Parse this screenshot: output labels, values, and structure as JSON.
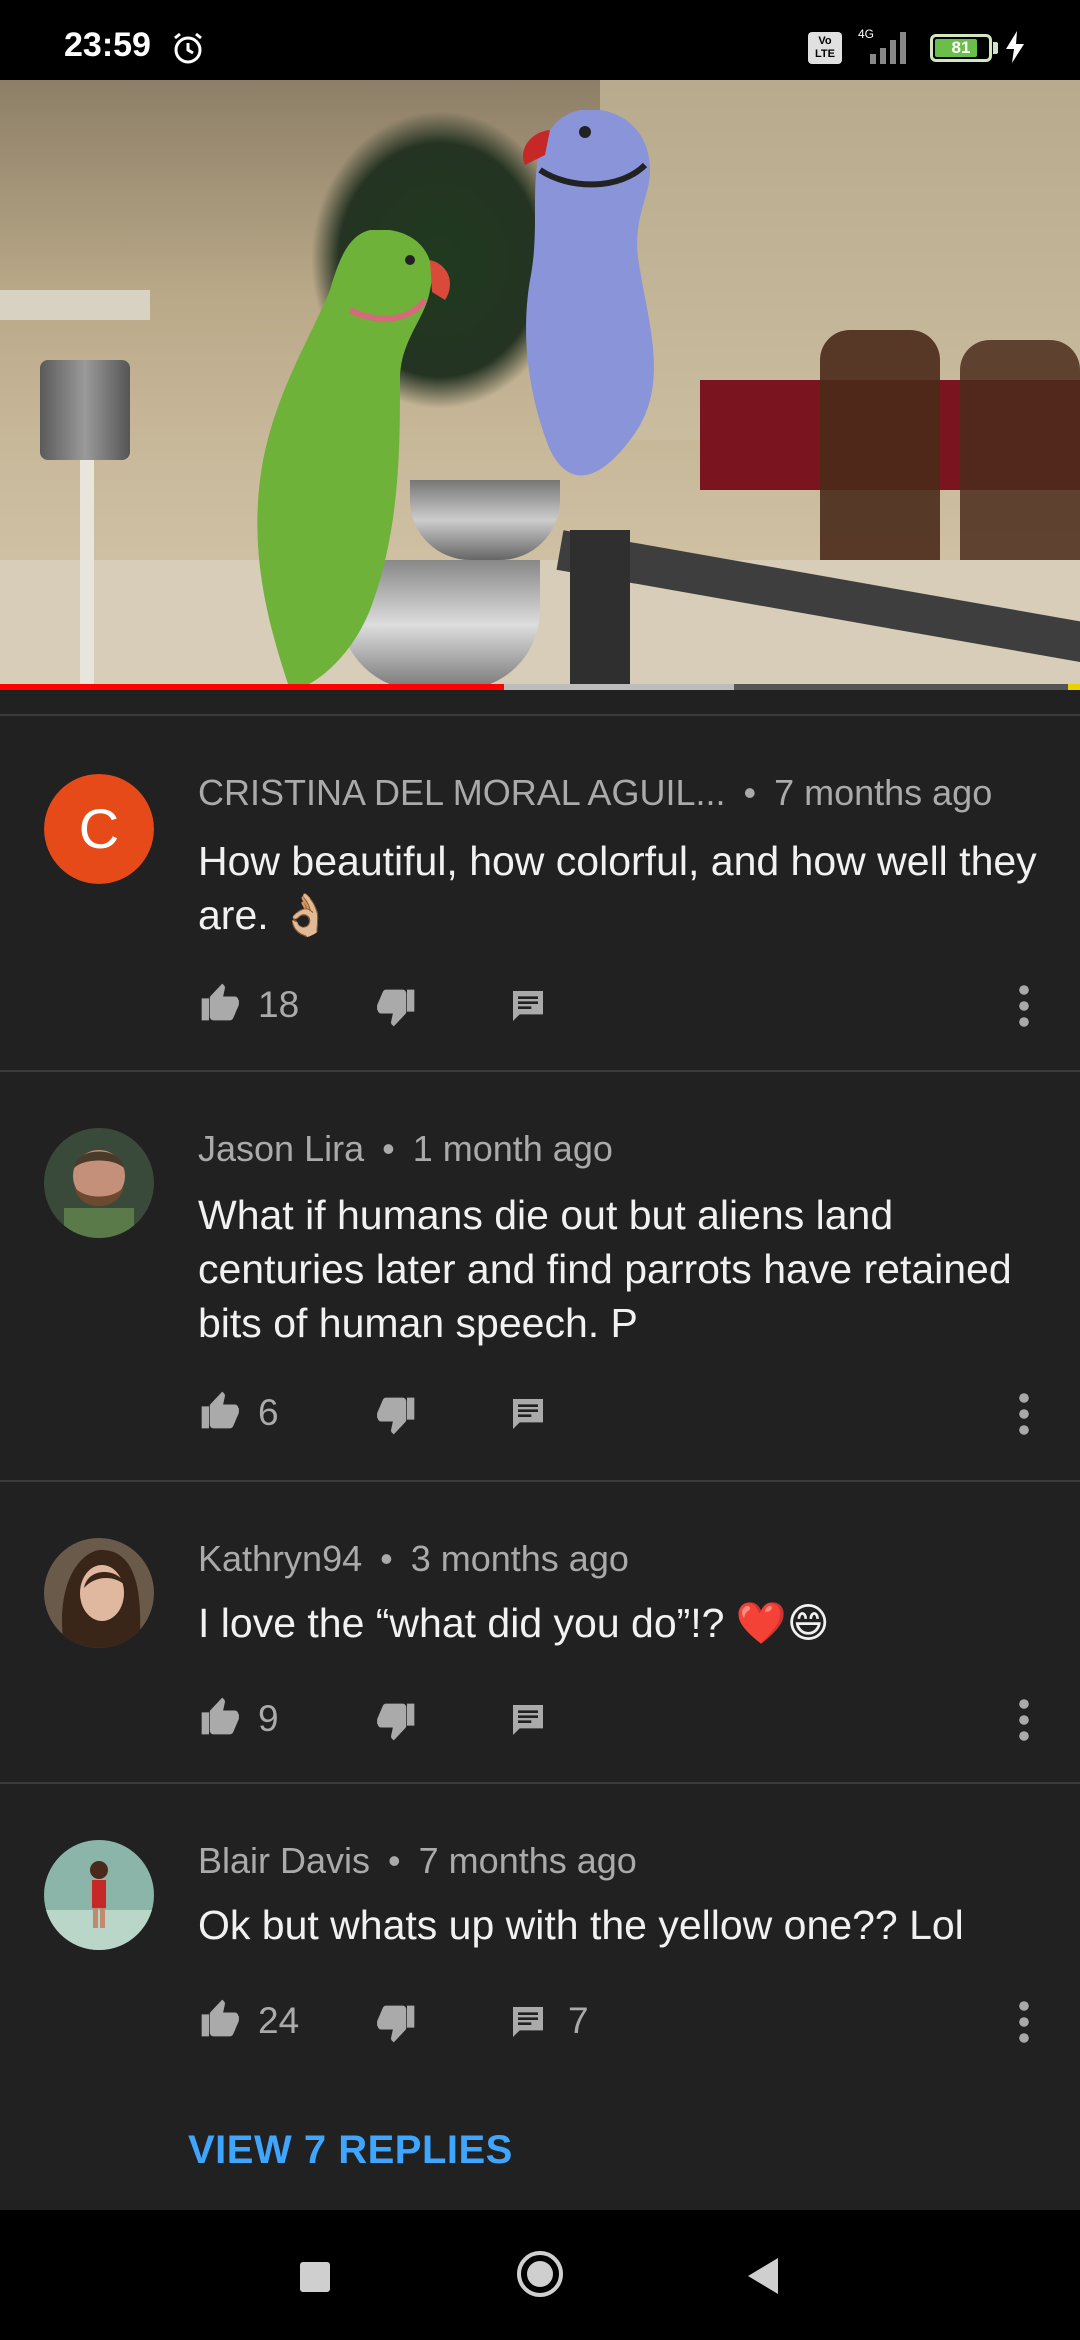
{
  "status_bar": {
    "time": "23:59",
    "network": "4G",
    "volte": "Vo LTE",
    "battery": "81",
    "battery_level": 0.81,
    "icons": [
      "alarm-icon",
      "signal-icon",
      "battery-icon",
      "charging-bolt-icon"
    ]
  },
  "video": {
    "progress_played": 0.467,
    "progress_buffered": 0.68
  },
  "comments": [
    {
      "author": "CRISTINA DEL MORAL AGUIL...",
      "time": "7 months ago",
      "avatar_letter": "C",
      "text": "How beautiful, how colorful, and how well they are. 👌🏼",
      "likes": "18",
      "replies": ""
    },
    {
      "author": "Jason Lira",
      "time": "1 month ago",
      "avatar_letter": "",
      "text": "What if humans die out but aliens land centuries later and find parrots have retained bits of human speech. P",
      "likes": "6",
      "replies": ""
    },
    {
      "author": "Kathryn94",
      "time": "3 months ago",
      "avatar_letter": "",
      "text": "I love the “what did you do”!? ❤️😄",
      "likes": "9",
      "replies": ""
    },
    {
      "author": "Blair Davis",
      "time": "7 months ago",
      "avatar_letter": "",
      "text": "Ok but whats up with the yellow one?? Lol",
      "likes": "24",
      "replies": "7"
    }
  ],
  "view_replies": "VIEW 7 REPLIES",
  "colors": {
    "background": "#212121",
    "accent_link": "#3ea6ff",
    "progress": "#ff0000",
    "avatar_c": "#e64a19"
  }
}
